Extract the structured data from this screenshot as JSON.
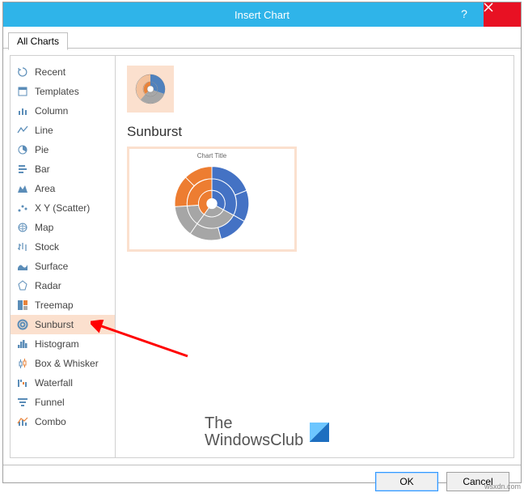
{
  "title": "Insert Chart",
  "tab": "All Charts",
  "sidebar": {
    "items": [
      {
        "label": "Recent"
      },
      {
        "label": "Templates"
      },
      {
        "label": "Column"
      },
      {
        "label": "Line"
      },
      {
        "label": "Pie"
      },
      {
        "label": "Bar"
      },
      {
        "label": "Area"
      },
      {
        "label": "X Y (Scatter)"
      },
      {
        "label": "Map"
      },
      {
        "label": "Stock"
      },
      {
        "label": "Surface"
      },
      {
        "label": "Radar"
      },
      {
        "label": "Treemap"
      },
      {
        "label": "Sunburst"
      },
      {
        "label": "Histogram"
      },
      {
        "label": "Box & Whisker"
      },
      {
        "label": "Waterfall"
      },
      {
        "label": "Funnel"
      },
      {
        "label": "Combo"
      }
    ]
  },
  "chart": {
    "name": "Sunburst",
    "previewTitle": "Chart Title"
  },
  "buttons": {
    "ok": "OK",
    "cancel": "Cancel"
  },
  "watermark": {
    "line1": "The",
    "line2": "WindowsClub"
  },
  "source": "wsxdn.com"
}
